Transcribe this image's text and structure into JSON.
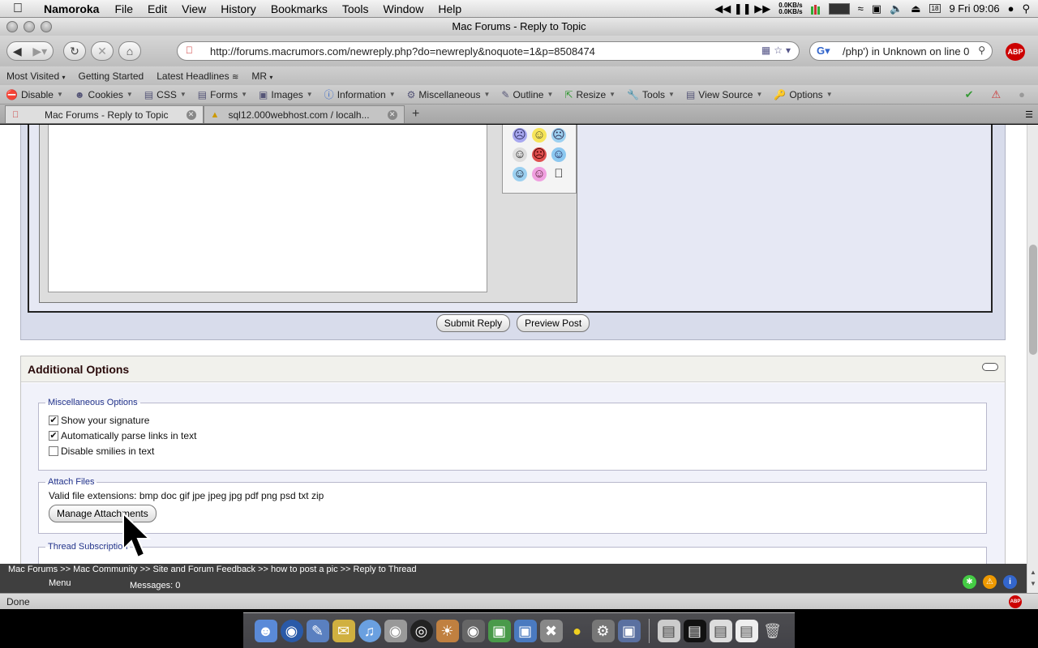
{
  "menubar": {
    "app_name": "Namoroka",
    "items": [
      "File",
      "Edit",
      "View",
      "History",
      "Bookmarks",
      "Tools",
      "Window",
      "Help"
    ],
    "net_up": "0.0KB/s",
    "net_down": "0.0KB/s",
    "clock": "9 Fri 09:06",
    "calendar_day": "18"
  },
  "window": {
    "title": "Mac Forums - Reply to Topic"
  },
  "navbar": {
    "url": "http://forums.macrumors.com/newreply.php?do=newreply&noquote=1&p=8508474",
    "search_value": "/php') in Unknown on line 0",
    "abp": "ABP"
  },
  "bookmarks": [
    "Most Visited",
    "Getting Started",
    "Latest Headlines",
    "MR"
  ],
  "devtools": [
    "Disable",
    "Cookies",
    "CSS",
    "Forms",
    "Images",
    "Information",
    "Miscellaneous",
    "Outline",
    "Resize",
    "Tools",
    "View Source",
    "Options"
  ],
  "tabs": [
    {
      "label": "Mac Forums - Reply to Topic"
    },
    {
      "label": "sql12.000webhost.com / localh..."
    }
  ],
  "reply": {
    "submit_label": "Submit Reply",
    "preview_label": "Preview Post"
  },
  "options": {
    "title": "Additional Options",
    "misc_legend": "Miscellaneous Options",
    "checkboxes": [
      {
        "label": "Show your signature",
        "checked": true
      },
      {
        "label": "Automatically parse links in text",
        "checked": true
      },
      {
        "label": "Disable smilies in text",
        "checked": false
      }
    ],
    "attach_legend": "Attach Files",
    "extensions": "Valid file extensions: bmp doc gif jpe jpeg jpg pdf png psd txt zip",
    "manage_label": "Manage Attachments",
    "thread_legend": "Thread Subscription"
  },
  "vbbar": {
    "breadcrumb": "Mac Forums >> Mac Community >> Site and Forum Feedback >> how to post a pic >> Reply to Thread",
    "menu": "Menu",
    "messages": "Messages: 0"
  },
  "status": {
    "text": "Done"
  }
}
